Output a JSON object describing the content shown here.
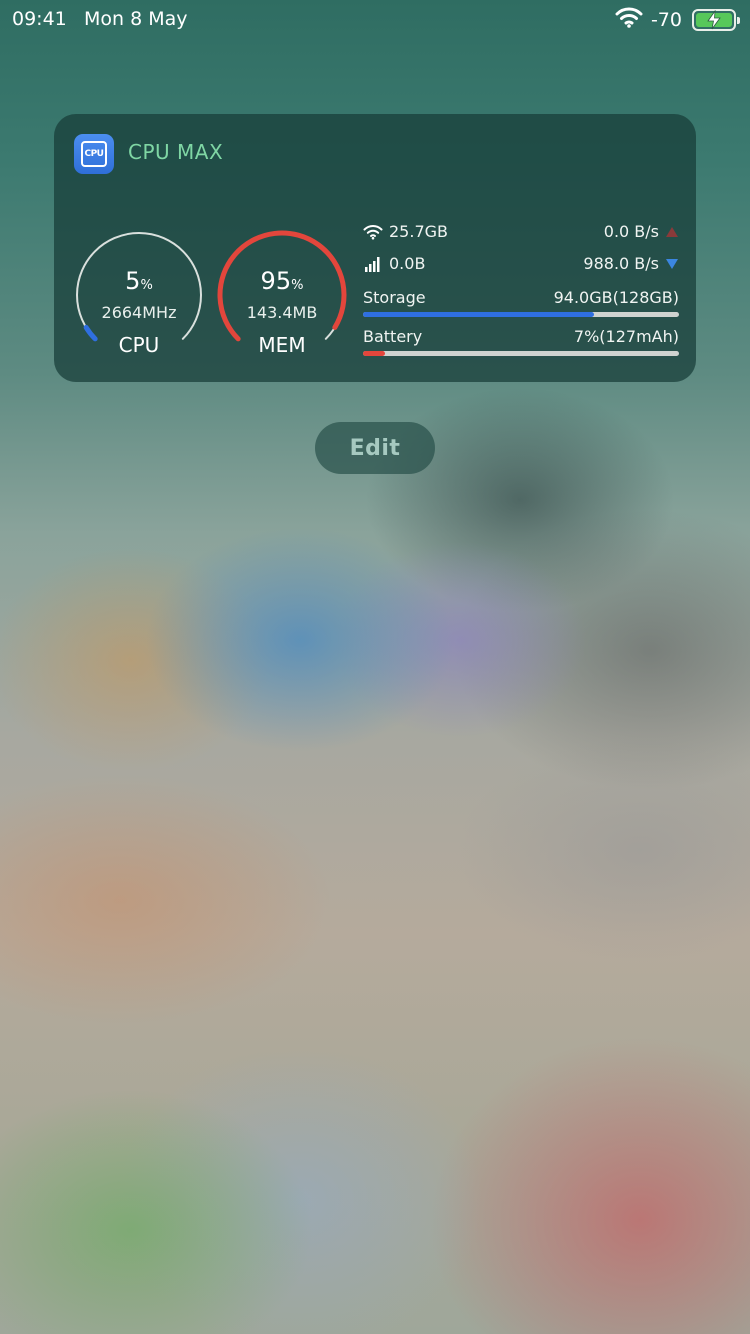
{
  "status_bar": {
    "time": "09:41",
    "date": "Mon 8 May",
    "signal": "-70",
    "battery_color": "#57c85a"
  },
  "widget": {
    "app_name": "CPU MAX",
    "app_icon_text": "CPU",
    "cpu": {
      "percent": "5",
      "unit": "%",
      "detail": "2664MHz",
      "label": "CPU",
      "fraction": 0.05,
      "color": "#2f6fe0"
    },
    "mem": {
      "percent": "95",
      "unit": "%",
      "detail": "143.4MB",
      "label": "MEM",
      "fraction": 0.95,
      "color": "#e3463c"
    },
    "wifi": {
      "total": "25.7GB",
      "speed": "0.0 B/s"
    },
    "cellular": {
      "total": "0.0B",
      "speed": "988.0 B/s"
    },
    "storage": {
      "label": "Storage",
      "value": "94.0GB(128GB)",
      "fraction": 0.73,
      "color": "#2f6fe0"
    },
    "battery": {
      "label": "Battery",
      "value": "7%(127mAh)",
      "fraction": 0.07,
      "color": "#e3463c"
    }
  },
  "edit_label": "Edit"
}
